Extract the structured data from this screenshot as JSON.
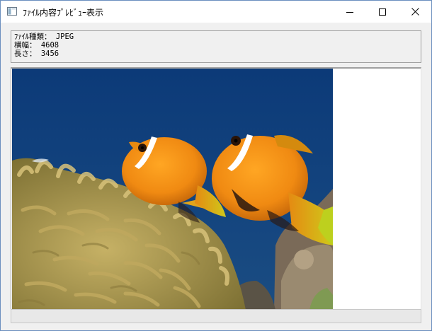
{
  "window": {
    "title": "ﾌｧｲﾙ内容ﾌﾟﾚﾋﾞｭｰ表示",
    "icon": "app-window-icon"
  },
  "controls": {
    "minimize_icon": "minimize-icon",
    "maximize_icon": "maximize-icon",
    "close_icon": "close-icon"
  },
  "info": {
    "file_type": "ﾌｧｲﾙ種類： JPEG",
    "width": "横幅： 4608",
    "height": "長さ： 3456"
  },
  "preview": {
    "image_subject": "clownfish-anemone-photo"
  }
}
